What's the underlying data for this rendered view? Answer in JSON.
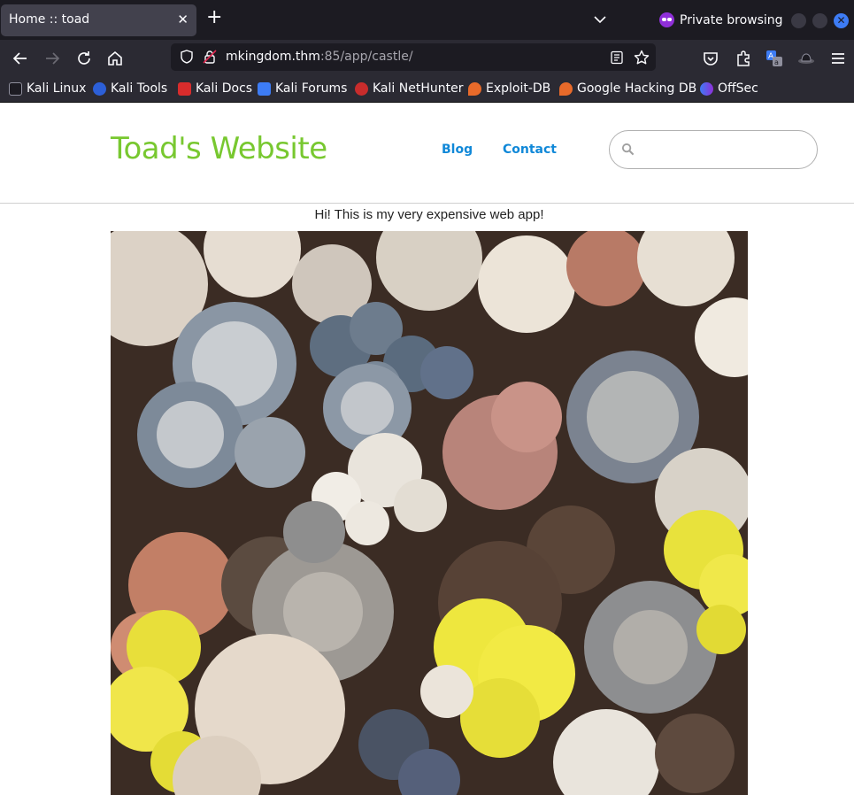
{
  "browser": {
    "tab": {
      "title": "Home :: toad"
    },
    "private_label": "Private browsing",
    "url": {
      "host": "mkingdom.thm",
      "path": ":85/app/castle/"
    },
    "bookmarks": [
      {
        "label": "Kali Linux",
        "icon": "kali-dragon-icon"
      },
      {
        "label": "Kali Tools",
        "icon": "kali-tools-icon"
      },
      {
        "label": "Kali Docs",
        "icon": "kali-docs-icon"
      },
      {
        "label": "Kali Forums",
        "icon": "kali-forums-icon"
      },
      {
        "label": "Kali NetHunter",
        "icon": "kali-nethunter-icon"
      },
      {
        "label": "Exploit-DB",
        "icon": "exploit-db-icon"
      },
      {
        "label": "Google Hacking DB",
        "icon": "ghdb-icon"
      },
      {
        "label": "OffSec",
        "icon": "offsec-icon"
      }
    ]
  },
  "site": {
    "title": "Toad's Website",
    "nav": {
      "blog": "Blog",
      "contact": "Contact"
    },
    "search_placeholder": "",
    "intro": "Hi! This is my very expensive web app!",
    "image": {
      "alt": "mushrooms-photo"
    }
  },
  "colors": {
    "title_green": "#78c830",
    "link_blue": "#1088d8",
    "chrome_dark": "#1c1b22"
  }
}
